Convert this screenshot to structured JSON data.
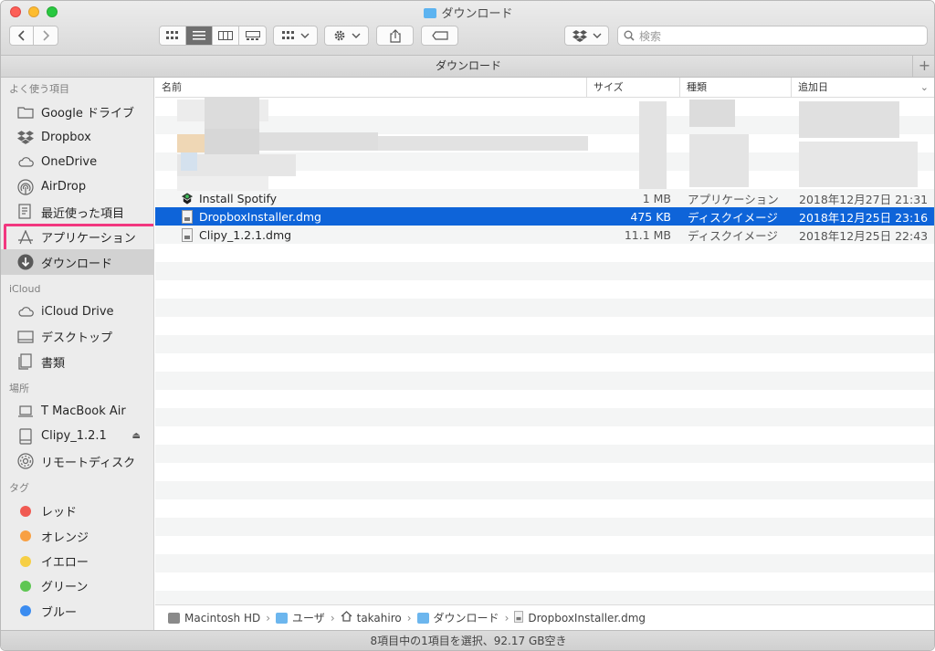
{
  "window": {
    "title": "ダウンロード"
  },
  "toolbar": {
    "back_icon": "chevron-left-icon",
    "forward_icon": "chevron-right-icon",
    "view_modes": [
      "icon-view-icon",
      "list-view-icon",
      "column-view-icon",
      "gallery-view-icon"
    ],
    "active_view": 1,
    "group_icon": "group-by-icon",
    "action_icon": "gear-icon",
    "share_icon": "share-icon",
    "tag_icon": "tag-icon",
    "dropbox_icon": "dropbox-icon",
    "search_placeholder": "検索"
  },
  "path_header": {
    "title": "ダウンロード",
    "add_label": "+"
  },
  "sidebar": {
    "favorites_title": "よく使う項目",
    "favorites": [
      {
        "label": "Google ドライブ",
        "icon": "folder-icon"
      },
      {
        "label": "Dropbox",
        "icon": "dropbox-icon"
      },
      {
        "label": "OneDrive",
        "icon": "cloud-icon"
      },
      {
        "label": "AirDrop",
        "icon": "airdrop-icon"
      },
      {
        "label": "最近使った項目",
        "icon": "recents-icon"
      },
      {
        "label": "アプリケーション",
        "icon": "applications-icon"
      },
      {
        "label": "ダウンロード",
        "icon": "downloads-icon"
      }
    ],
    "icloud_title": "iCloud",
    "icloud": [
      {
        "label": "iCloud Drive",
        "icon": "cloud-icon"
      },
      {
        "label": "デスクトップ",
        "icon": "desktop-icon"
      },
      {
        "label": "書類",
        "icon": "documents-icon"
      }
    ],
    "locations_title": "場所",
    "locations": [
      {
        "label": "T MacBook Air",
        "icon": "laptop-icon"
      },
      {
        "label": "Clipy_1.2.1",
        "icon": "disk-icon",
        "eject": "⏏"
      },
      {
        "label": "リモートディスク",
        "icon": "remote-disc-icon"
      }
    ],
    "tags_title": "タグ",
    "tags": [
      {
        "label": "レッド",
        "color": "#f05a52"
      },
      {
        "label": "オレンジ",
        "color": "#f8a043"
      },
      {
        "label": "イエロー",
        "color": "#f6cf45"
      },
      {
        "label": "グリーン",
        "color": "#5ec653"
      },
      {
        "label": "ブルー",
        "color": "#3b8cf0"
      }
    ]
  },
  "columns": {
    "name": "名前",
    "size": "サイズ",
    "kind": "種類",
    "date": "追加日"
  },
  "files": [
    {
      "name": "Install Spotify",
      "size": "1 MB",
      "kind": "アプリケーション",
      "date": "2018年12月27日 21:31",
      "icon": "spotify-installer-icon"
    },
    {
      "name": "DropboxInstaller.dmg",
      "size": "475 KB",
      "kind": "ディスクイメージ",
      "date": "2018年12月25日 23:16",
      "icon": "dmg-icon",
      "selected": true
    },
    {
      "name": "Clipy_1.2.1.dmg",
      "size": "11.1 MB",
      "kind": "ディスクイメージ",
      "date": "2018年12月25日 22:43",
      "icon": "dmg-icon"
    }
  ],
  "pathbar": [
    "Macintosh HD",
    "ユーザ",
    "takahiro",
    "ダウンロード",
    "DropboxInstaller.dmg"
  ],
  "status": "8項目中の1項目を選択、92.17 GB空き"
}
